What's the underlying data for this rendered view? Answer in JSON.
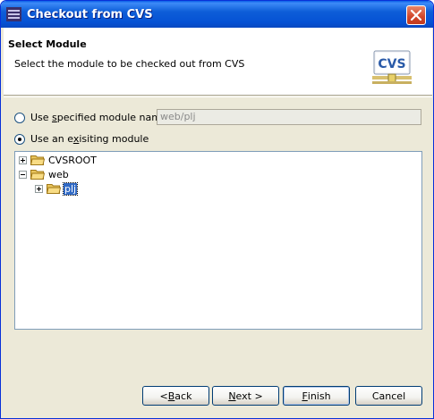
{
  "window": {
    "title": "Checkout from CVS",
    "close_label": "Close"
  },
  "header": {
    "title": "Select Module",
    "description": "Select the module to be checked out from CVS",
    "logo_text": "CVS"
  },
  "options": {
    "specified": {
      "label_pre": "Use ",
      "label_mnemonic": "s",
      "label_post": "pecified module name:",
      "selected": false
    },
    "existing": {
      "label_pre": "Use an e",
      "label_mnemonic": "x",
      "label_post": "isiting module",
      "selected": true
    },
    "module_name_value": "web/plj"
  },
  "tree": {
    "nodes": [
      {
        "label": "CVSROOT",
        "expanded": false,
        "depth": 0
      },
      {
        "label": "web",
        "expanded": true,
        "depth": 0
      },
      {
        "label": "plj",
        "expanded": false,
        "depth": 1,
        "selected": true
      }
    ]
  },
  "buttons": {
    "back": {
      "pre": "< ",
      "mnemonic": "B",
      "post": "ack"
    },
    "next": {
      "pre": "",
      "mnemonic": "N",
      "post": "ext >"
    },
    "finish": {
      "pre": "",
      "mnemonic": "F",
      "post": "inish"
    },
    "cancel": {
      "pre": "Cancel",
      "mnemonic": "",
      "post": ""
    }
  },
  "colors": {
    "titlebar": "#0551d4",
    "selection": "#316ac5",
    "folder": "#e8c45c"
  },
  "icons": {
    "app": "eclipse-icon",
    "close": "close-icon",
    "logo": "cvs-logo-icon",
    "folder": "folder-icon"
  }
}
